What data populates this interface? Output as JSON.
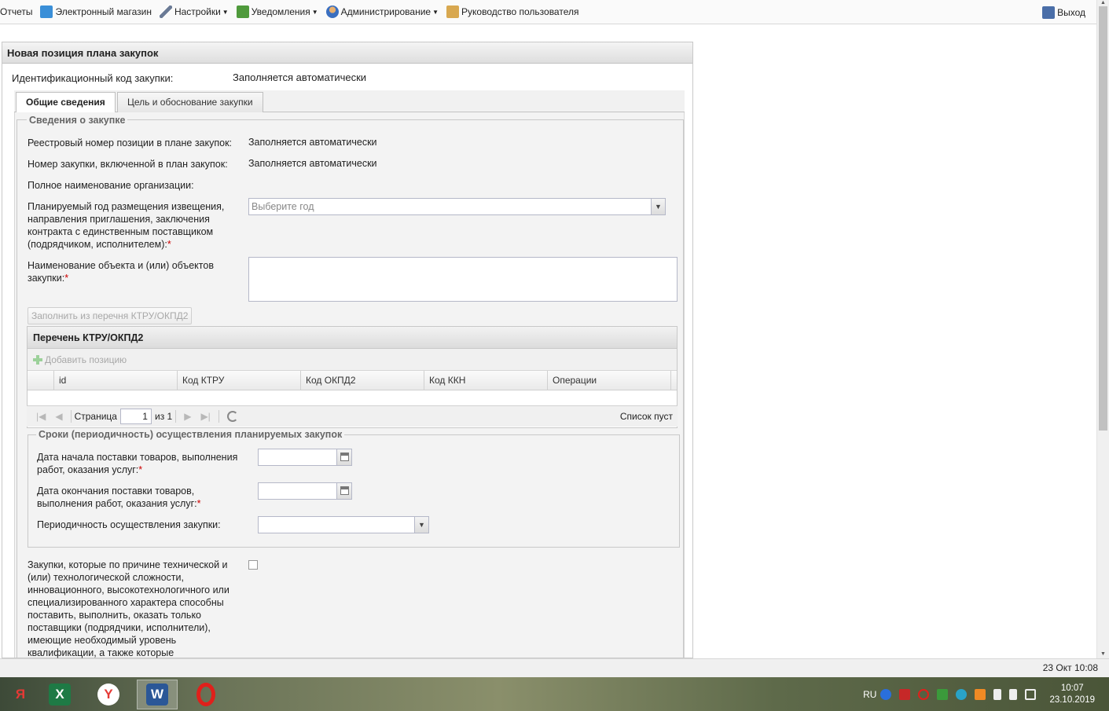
{
  "menu": {
    "items": [
      {
        "label": "Отчеты",
        "icon": "reports-icon"
      },
      {
        "label": "Электронный магазин",
        "icon": "shop-icon"
      },
      {
        "label": "Настройки",
        "icon": "wrench-icon",
        "dropdown": true
      },
      {
        "label": "Уведомления",
        "icon": "notifications-icon",
        "dropdown": true
      },
      {
        "label": "Администрирование",
        "icon": "user-admin-icon",
        "dropdown": true
      },
      {
        "label": "Руководство пользователя",
        "icon": "manual-icon"
      }
    ],
    "logout": "Выход"
  },
  "panel": {
    "title": "Новая позиция плана закупок",
    "ident_label": "Идентификационный код закупки:",
    "ident_value": "Заполняется автоматически",
    "tabs": [
      {
        "label": "Общие сведения",
        "active": true
      },
      {
        "label": "Цель и обоснование закупки",
        "active": false
      }
    ]
  },
  "info_section": {
    "legend": "Сведения о закупке",
    "registry_label": "Реестровый номер позиции в плане закупок:",
    "registry_value": "Заполняется автоматически",
    "purchase_no_label": "Номер закупки, включенной в план закупок:",
    "purchase_no_value": "Заполняется автоматически",
    "org_label": "Полное наименование организации:",
    "year_label": "Планируемый год размещения извещения, направления приглашения, заключения контракта с единственным поставщиком (подрядчиком, исполнителем):",
    "year_placeholder": "Выберите год",
    "object_label": "Наименование объекта и (или) объектов закупки:",
    "required_mark": "*",
    "fill_button": "Заполнить из перечня КТРУ/ОКПД2"
  },
  "grid": {
    "title": "Перечень КТРУ/ОКПД2",
    "add_button": "Добавить позицию",
    "columns": [
      "id",
      "Код КТРУ",
      "Код ОКПД2",
      "Код ККН",
      "Операции"
    ],
    "pager": {
      "page_label": "Страница",
      "page_value": "1",
      "of_label": "из 1",
      "empty_text": "Список пуст"
    }
  },
  "terms_section": {
    "legend": "Сроки (периодичность) осуществления планируемых закупок",
    "start_label": "Дата начала поставки товаров, выполнения работ, оказания услуг:",
    "end_label": "Дата окончания поставки товаров, выполнения работ, оказания услуг:",
    "period_label": "Периодичность осуществления закупки:"
  },
  "complexity": {
    "label": "Закупки, которые по причине технической и (или) технологической сложности, инновационного, высокотехнологичного или специализированного характера способны поставить, выполнить, оказать только поставщики (подрядчики, исполнители), имеющие необходимый уровень квалификации, а также которые",
    "checked": false
  },
  "statusbar": {
    "datetime": "23 Окт 10:08"
  },
  "taskbar": {
    "lang": "RU",
    "time": "10:07",
    "date": "23.10.2019",
    "apps": [
      "yandex-icon",
      "excel-icon",
      "yandex-browser-icon",
      "word-icon",
      "opera-icon"
    ]
  }
}
